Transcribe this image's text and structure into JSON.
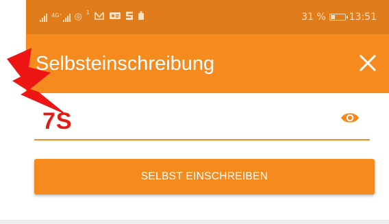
{
  "status_bar": {
    "network_label": "4G⁺\n4G",
    "notification_badge": "1",
    "wifi_glyph": "◎",
    "icons": [
      "signal-icon",
      "signal-icon",
      "wifi-icon",
      "notification-icon",
      "message-icon",
      "app-icon",
      "app-icon"
    ],
    "battery_percent_text": "31 %",
    "battery_level": 0.31,
    "time": "13:51"
  },
  "app_bar": {
    "title": "Selbsteinschreibung",
    "close_icon": "close-icon"
  },
  "enrollment_form": {
    "code_value": "7S",
    "visibility_icon": "eye-icon",
    "submit_label": "SELBST EINSCHREIBEN"
  },
  "annotation": {
    "icon": "lightning-icon"
  },
  "colors": {
    "accent": "#f58a1f",
    "status_bar": "#e07d1a",
    "code_text": "#e11b14",
    "annotation": "#ee1515"
  }
}
